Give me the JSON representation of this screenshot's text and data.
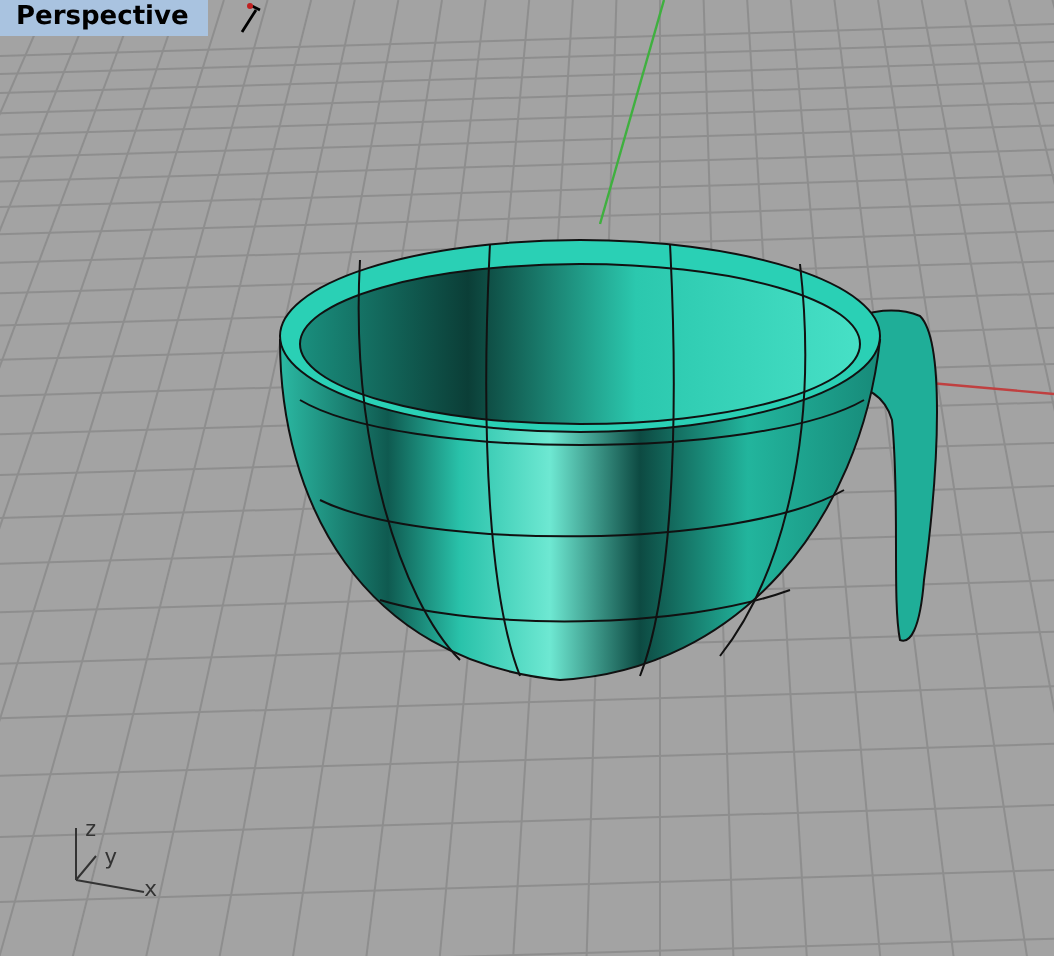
{
  "viewport": {
    "title": "Perspective"
  },
  "axis_labels": [
    {
      "kind": "z",
      "label": "z"
    },
    {
      "kind": "y",
      "label": "y"
    },
    {
      "kind": "x",
      "label": "x"
    }
  ]
}
